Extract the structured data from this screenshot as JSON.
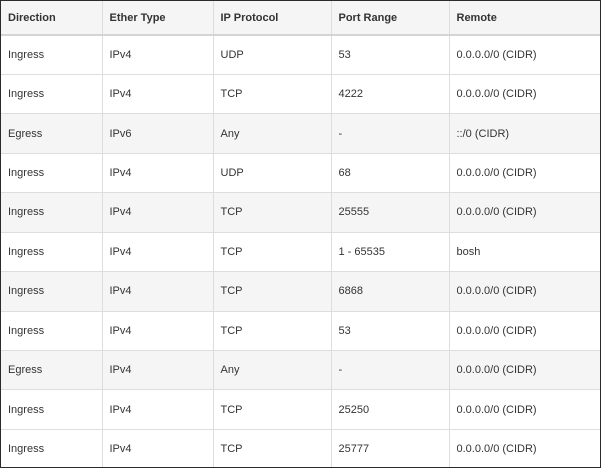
{
  "table": {
    "columns": [
      "Direction",
      "Ether Type",
      "IP Protocol",
      "Port Range",
      "Remote"
    ],
    "rows": [
      {
        "direction": "Ingress",
        "ether_type": "IPv4",
        "ip_protocol": "UDP",
        "port_range": "53",
        "remote": "0.0.0.0/0 (CIDR)"
      },
      {
        "direction": "Ingress",
        "ether_type": "IPv4",
        "ip_protocol": "TCP",
        "port_range": "4222",
        "remote": "0.0.0.0/0 (CIDR)"
      },
      {
        "direction": "Egress",
        "ether_type": "IPv6",
        "ip_protocol": "Any",
        "port_range": "-",
        "remote": "::/0 (CIDR)"
      },
      {
        "direction": "Ingress",
        "ether_type": "IPv4",
        "ip_protocol": "UDP",
        "port_range": "68",
        "remote": "0.0.0.0/0 (CIDR)"
      },
      {
        "direction": "Ingress",
        "ether_type": "IPv4",
        "ip_protocol": "TCP",
        "port_range": "25555",
        "remote": "0.0.0.0/0 (CIDR)"
      },
      {
        "direction": "Ingress",
        "ether_type": "IPv4",
        "ip_protocol": "TCP",
        "port_range": "1 - 65535",
        "remote": "bosh"
      },
      {
        "direction": "Ingress",
        "ether_type": "IPv4",
        "ip_protocol": "TCP",
        "port_range": "6868",
        "remote": "0.0.0.0/0 (CIDR)"
      },
      {
        "direction": "Ingress",
        "ether_type": "IPv4",
        "ip_protocol": "TCP",
        "port_range": "53",
        "remote": "0.0.0.0/0 (CIDR)"
      },
      {
        "direction": "Egress",
        "ether_type": "IPv4",
        "ip_protocol": "Any",
        "port_range": "-",
        "remote": "0.0.0.0/0 (CIDR)"
      },
      {
        "direction": "Ingress",
        "ether_type": "IPv4",
        "ip_protocol": "TCP",
        "port_range": "25250",
        "remote": "0.0.0.0/0 (CIDR)"
      },
      {
        "direction": "Ingress",
        "ether_type": "IPv4",
        "ip_protocol": "TCP",
        "port_range": "25777",
        "remote": "0.0.0.0/0 (CIDR)"
      }
    ]
  },
  "colors": {
    "header_bg": "#f5f5f5",
    "stripe_bg": "#f5f5f5",
    "border": "#dddddd",
    "text": "#333333",
    "frame_border": "#2b2b2b"
  }
}
